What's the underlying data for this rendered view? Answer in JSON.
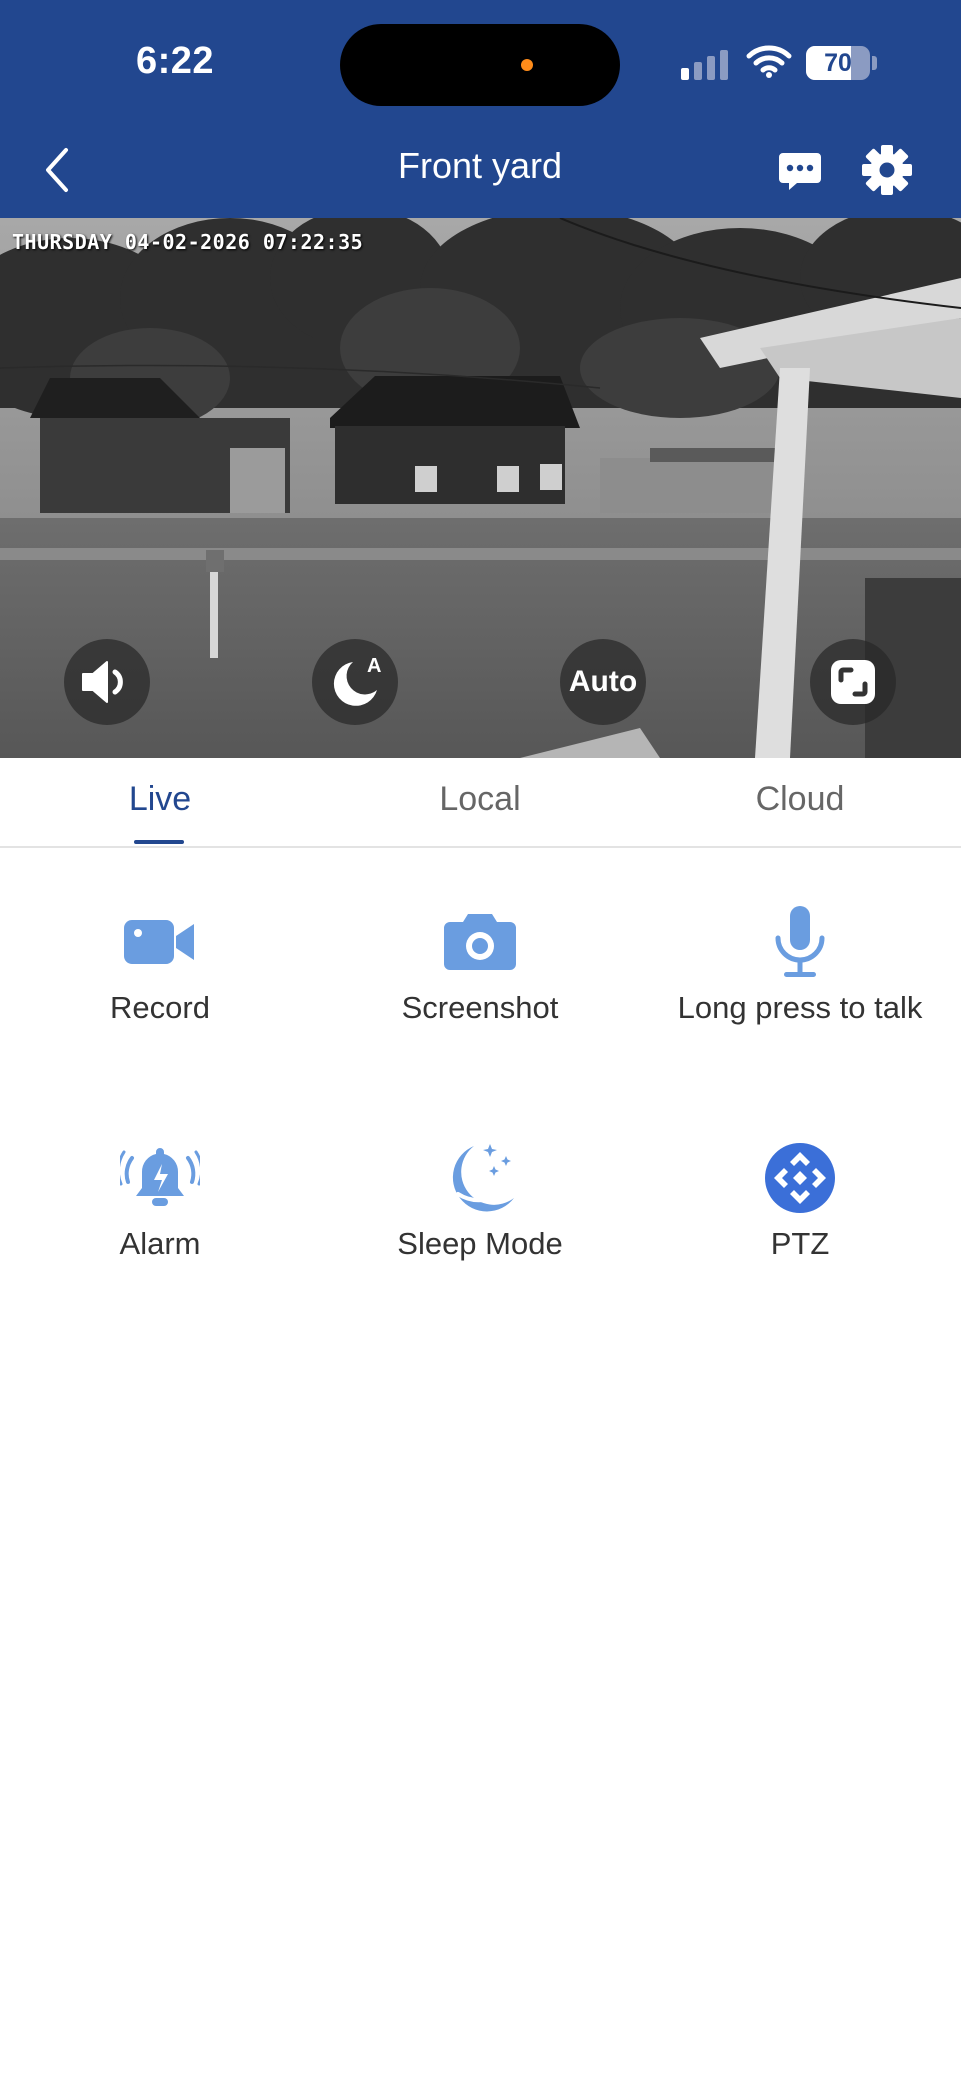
{
  "status_bar": {
    "time": "6:22",
    "battery": "70",
    "battery_level": 0.7,
    "cellular_bars_active": 1
  },
  "header": {
    "title": "Front yard",
    "back_icon": "chevron-left-icon",
    "message_icon": "chat-bubble-icon",
    "settings_icon": "gear-icon"
  },
  "feed": {
    "timestamp": "THURSDAY 04-02-2026 07:22:35",
    "controls": [
      {
        "name": "speaker-icon"
      },
      {
        "name": "night-mode-auto-icon"
      },
      {
        "label": "Auto"
      },
      {
        "name": "fullscreen-icon"
      }
    ]
  },
  "tabs": [
    {
      "label": "Live",
      "active": true
    },
    {
      "label": "Local",
      "active": false
    },
    {
      "label": "Cloud",
      "active": false
    }
  ],
  "actions": [
    {
      "label": "Record",
      "icon": "video-camera-icon"
    },
    {
      "label": "Screenshot",
      "icon": "camera-icon"
    },
    {
      "label": "Long press to talk",
      "icon": "microphone-icon"
    },
    {
      "label": "Alarm",
      "icon": "alarm-bell-icon"
    },
    {
      "label": "Sleep Mode",
      "icon": "moon-stars-icon"
    },
    {
      "label": "PTZ",
      "icon": "ptz-direction-icon"
    }
  ],
  "colors": {
    "header_bg": "#22478f",
    "accent": "#22478f",
    "icon_blue": "#6a9de0",
    "ptz_blue": "#3b6fd8",
    "recording_dot": "#ff8c1a"
  }
}
